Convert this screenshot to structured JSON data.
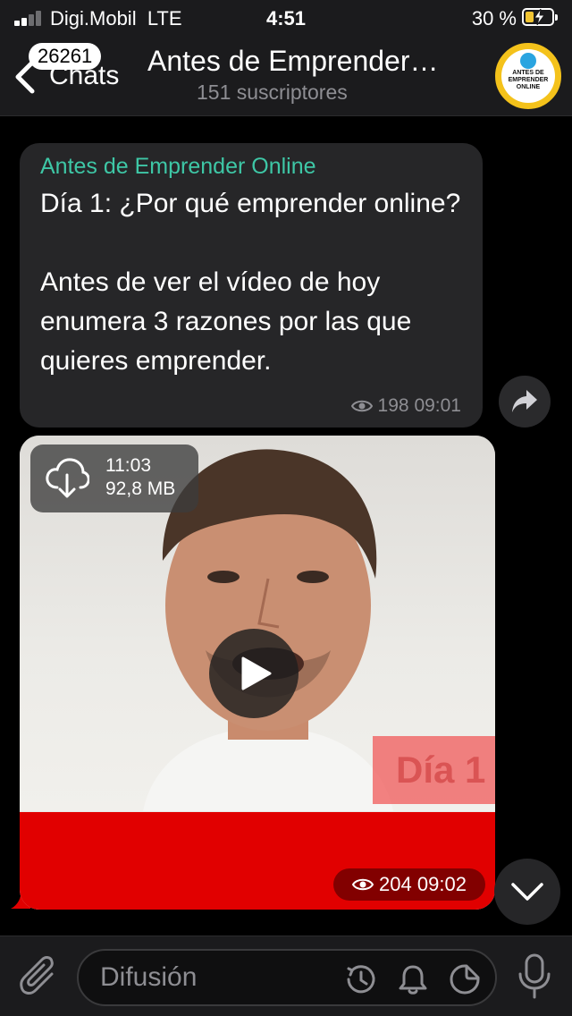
{
  "status_bar": {
    "carrier": "Digi.Mobil",
    "network": "LTE",
    "time": "4:51",
    "battery": "30 %",
    "battery_fraction": 0.3,
    "battery_color": "#f2c533"
  },
  "nav": {
    "back_label": "Chats",
    "unread_count": "26261",
    "title": "Antes de Emprender…",
    "subtitle": "151 suscriptores",
    "avatar_text": "ANTES DE EMPRENDER ONLINE"
  },
  "messages": [
    {
      "author": "Antes de Emprender Online",
      "text": "Día 1: ¿Por qué emprender online?\n\nAntes de ver el vídeo de hoy enumera 3 razones por las que quieres emprender.",
      "views": "198",
      "time": "09:01"
    },
    {
      "type": "video",
      "duration": "11:03",
      "size": "92,8 MB",
      "overlay_text": "Día 1",
      "views": "204",
      "time": "09:02"
    }
  ],
  "input": {
    "placeholder": "Difusión"
  },
  "colors": {
    "accent": "#3ec7a6",
    "video_strip": "#e10000"
  }
}
